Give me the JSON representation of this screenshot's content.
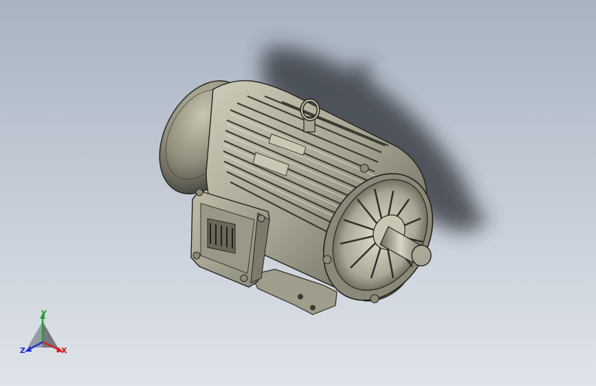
{
  "viewport": {
    "background_top": "#a9b4c3",
    "background_bottom": "#dfe4ea",
    "model_fill": "#b8b6a2",
    "model_dark": "#4e4c40",
    "model_edge": "#1e1d18",
    "shadow_color": "#2a2d33"
  },
  "triad": {
    "x_label": "X",
    "y_label": "Y",
    "z_label": "Z",
    "x_color": "#d42020",
    "y_color": "#20a030",
    "z_color": "#2030d0"
  }
}
